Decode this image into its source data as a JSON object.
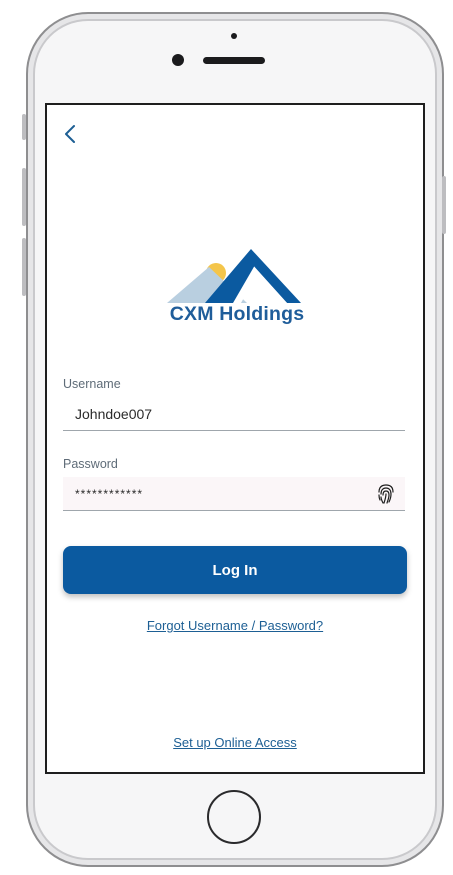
{
  "header": {
    "back_icon": "chevron-left-icon"
  },
  "brand": {
    "name": "CXM Holdings",
    "colors": {
      "navy": "#1f5d9a",
      "mountain_dark": "#0b5aa0",
      "mountain_light": "#b9cfe0",
      "sun": "#f4c54a"
    }
  },
  "form": {
    "username_label": "Username",
    "username_value": "Johndoe007",
    "password_label": "Password",
    "password_value": "************",
    "biometric_icon": "fingerprint-icon"
  },
  "actions": {
    "login_label": "Log In",
    "forgot_label": "Forgot Username / Password?",
    "setup_label": "Set up Online Access"
  },
  "colors": {
    "primary": "#0b5aa0",
    "link": "#1d5f94"
  }
}
